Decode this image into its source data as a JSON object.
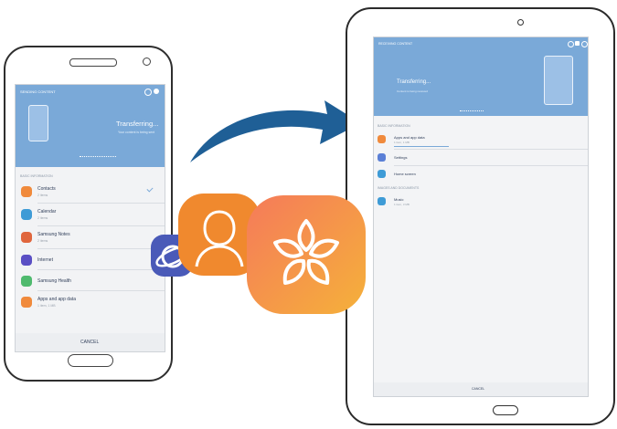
{
  "phone": {
    "header_title": "SENDING CONTENT",
    "status": "Transferring...",
    "status_sub": "Your content is being sent",
    "section": "BASIC INFORMATION",
    "items": [
      {
        "label": "Contacts",
        "sub": "2 items",
        "color": "#f08a3c",
        "icon": "contact-icon"
      },
      {
        "label": "Calendar",
        "sub": "2 items",
        "color": "#3e9bd6",
        "icon": "calendar-icon"
      },
      {
        "label": "Samsung Notes",
        "sub": "2 items",
        "color": "#e0663d",
        "icon": "notes-icon"
      },
      {
        "label": "Internet",
        "sub": "",
        "color": "#5a4fc4",
        "icon": "internet-icon"
      },
      {
        "label": "Samsung Health",
        "sub": "",
        "color": "#4fba6e",
        "icon": "health-icon"
      },
      {
        "label": "Apps and app data",
        "sub": "1 item, 1 MB",
        "color": "#f08a3c",
        "icon": "apps-icon"
      }
    ],
    "cancel": "CANCEL"
  },
  "tablet": {
    "header_title": "RECEIVING CONTENT",
    "status": "Transferring...",
    "status_sub": "Content is being received",
    "section1": "BASIC INFORMATION",
    "items1": [
      {
        "label": "Apps and app data",
        "sub": "1 item, 1 MB",
        "color": "#f08a3c",
        "icon": "apps-icon"
      },
      {
        "label": "Settings",
        "sub": "",
        "color": "#5a7fd6",
        "icon": "settings-icon"
      },
      {
        "label": "Home screen",
        "sub": "",
        "color": "#3e9bd6",
        "icon": "home-screen-icon"
      }
    ],
    "section2": "IMAGES AND DOCUMENTS",
    "items2": [
      {
        "label": "Music",
        "sub": "1 item, 3 MB",
        "color": "#3e9bd6",
        "icon": "music-icon"
      }
    ],
    "cancel": "CANCEL"
  },
  "floating_icons": [
    {
      "icon": "internet-app-icon",
      "color": "#4a5ab8"
    },
    {
      "icon": "contacts-app-icon",
      "color": "#f0892e"
    },
    {
      "icon": "gallery-app-icon",
      "color": "#f3a63a"
    }
  ],
  "colors": {
    "accent": "#7aa9d8",
    "arrow": "#1f5f96"
  }
}
